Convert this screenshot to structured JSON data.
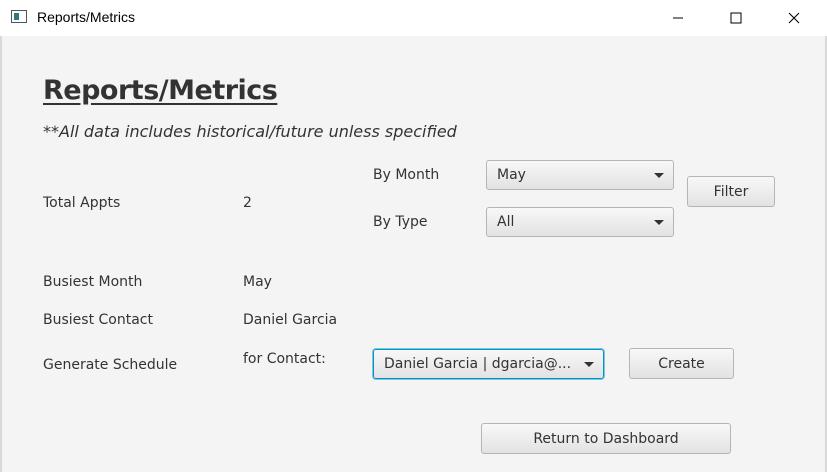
{
  "window": {
    "title": "Reports/Metrics"
  },
  "page": {
    "heading": "Reports/Metrics",
    "note": "**All data includes historical/future unless specified"
  },
  "filters": {
    "by_month_label": "By Month",
    "month_value": "May",
    "by_type_label": "By Type",
    "type_value": "All",
    "filter_button": "Filter"
  },
  "metrics": {
    "total_appts_label": "Total Appts",
    "total_appts_value": "2",
    "busiest_month_label": "Busiest Month",
    "busiest_month_value": "May",
    "busiest_contact_label": "Busiest Contact",
    "busiest_contact_value": "Daniel Garcia"
  },
  "schedule": {
    "label": "Generate Schedule",
    "for_contact_label": "for Contact:",
    "contact_value": "Daniel Garcia | dgarcia@...",
    "create_button": "Create"
  },
  "footer": {
    "return_button": "Return to Dashboard"
  }
}
